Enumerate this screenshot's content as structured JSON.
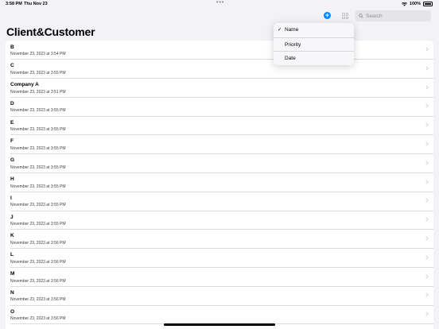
{
  "status_bar": {
    "time": "3:58 PM",
    "date": "Thu Nov 23",
    "dots": "•••",
    "battery": "100%"
  },
  "toolbar": {
    "add_icon": "plus-circle-icon",
    "grid_icon": "grid-icon",
    "search_placeholder": "Search"
  },
  "page": {
    "title": "Client&Customer"
  },
  "sort_menu": {
    "items": [
      {
        "label": "Name",
        "checked": true
      },
      {
        "label": "Priority",
        "checked": false
      },
      {
        "label": "Date",
        "checked": false
      }
    ]
  },
  "list": {
    "rows": [
      {
        "title": "B",
        "subtitle": "November 23, 2023 at 3:54 PM"
      },
      {
        "title": "C",
        "subtitle": "November 23, 2023 at 3:55 PM"
      },
      {
        "title": "Company A",
        "subtitle": "November 23, 2023 at 3:51 PM"
      },
      {
        "title": "D",
        "subtitle": "November 23, 2023 at 3:55 PM"
      },
      {
        "title": "E",
        "subtitle": "November 23, 2023 at 3:55 PM"
      },
      {
        "title": "F",
        "subtitle": "November 23, 2023 at 3:55 PM"
      },
      {
        "title": "G",
        "subtitle": "November 23, 2023 at 3:55 PM"
      },
      {
        "title": "H",
        "subtitle": "November 23, 2023 at 3:55 PM"
      },
      {
        "title": "I",
        "subtitle": "November 23, 2023 at 3:55 PM"
      },
      {
        "title": "J",
        "subtitle": "November 23, 2023 at 3:55 PM"
      },
      {
        "title": "K",
        "subtitle": "November 23, 2023 at 3:56 PM"
      },
      {
        "title": "L",
        "subtitle": "November 23, 2023 at 3:56 PM"
      },
      {
        "title": "M",
        "subtitle": "November 23, 2023 at 3:56 PM"
      },
      {
        "title": "N",
        "subtitle": "November 23, 2023 at 3:56 PM"
      },
      {
        "title": "O",
        "subtitle": "November 23, 2023 at 3:56 PM"
      }
    ]
  },
  "colors": {
    "accent": "#0a84ff",
    "background": "#f2f2f7"
  }
}
